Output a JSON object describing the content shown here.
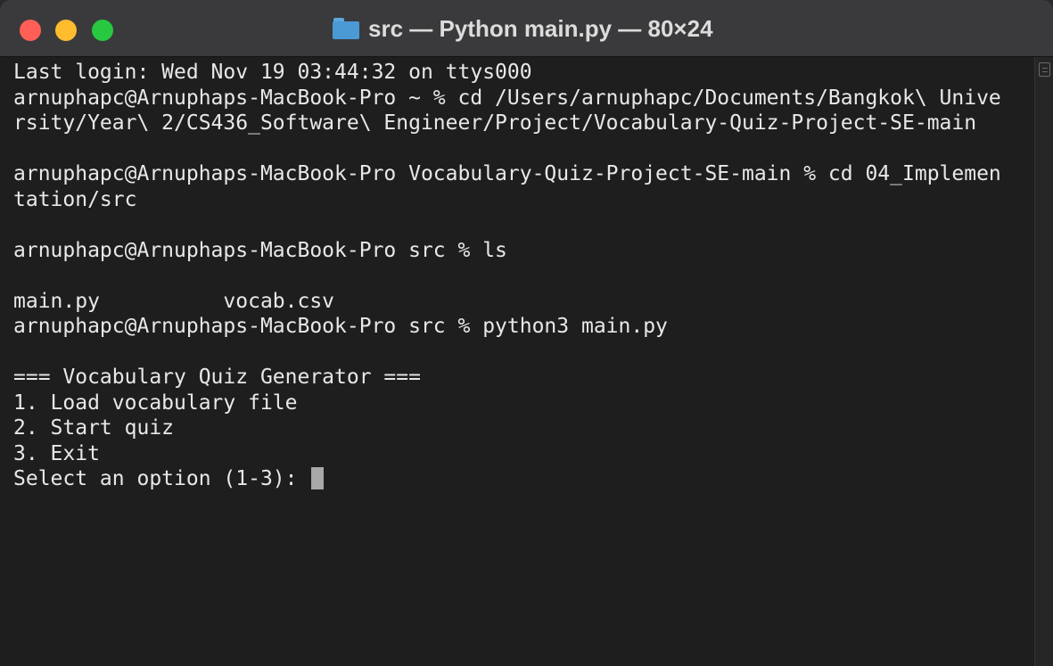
{
  "window": {
    "title": "src — Python main.py — 80×24",
    "folder_icon": "folder-icon",
    "controls": {
      "close_color": "#ff5f57",
      "minimize_color": "#febc2e",
      "zoom_color": "#28c840"
    }
  },
  "terminal": {
    "background": "#1e1e1e",
    "text_color": "#e8e8e8",
    "lines": [
      "Last login: Wed Nov 19 03:44:32 on ttys000",
      "arnuphapc@Arnuphaps-MacBook-Pro ~ % cd /Users/arnuphapc/Documents/Bangkok\\ Unive",
      "rsity/Year\\ 2/CS436_Software\\ Engineer/Project/Vocabulary-Quiz-Project-SE-main",
      "",
      "arnuphapc@Arnuphaps-MacBook-Pro Vocabulary-Quiz-Project-SE-main % cd 04_Implemen",
      "tation/src",
      "",
      "arnuphapc@Arnuphaps-MacBook-Pro src % ls",
      "",
      "main.py          vocab.csv",
      "arnuphapc@Arnuphaps-MacBook-Pro src % python3 main.py",
      "",
      "=== Vocabulary Quiz Generator ===",
      "1. Load vocabulary file",
      "2. Start quiz",
      "3. Exit"
    ],
    "prompt": "Select an option (1-3): "
  }
}
